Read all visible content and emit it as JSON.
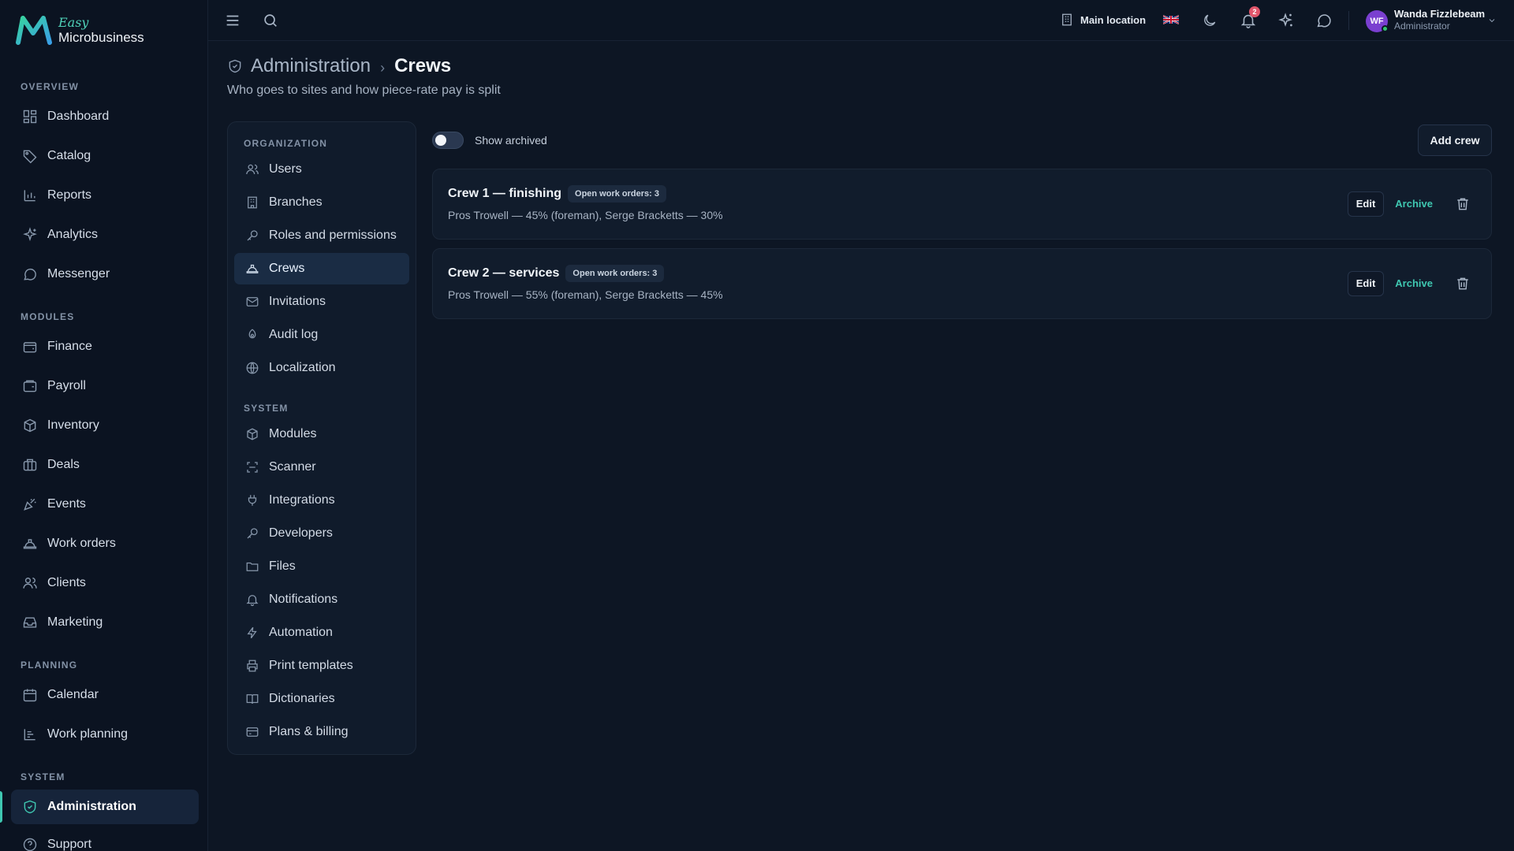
{
  "brand": {
    "line1": "Easy",
    "line2": "Microbusiness"
  },
  "colors": {
    "accent": "#3fc7b1",
    "background": "#0d1624",
    "badge": "#e0566b",
    "avatar": "#7a3fd0"
  },
  "sidebar": {
    "sections": [
      {
        "label": "OVERVIEW",
        "items": [
          {
            "label": "Dashboard",
            "icon": "dashboard-icon"
          },
          {
            "label": "Catalog",
            "icon": "tag-icon"
          },
          {
            "label": "Reports",
            "icon": "bar-chart-icon"
          },
          {
            "label": "Analytics",
            "icon": "sparkle-icon"
          },
          {
            "label": "Messenger",
            "icon": "chat-bubble-icon"
          }
        ]
      },
      {
        "label": "MODULES",
        "items": [
          {
            "label": "Finance",
            "icon": "wallet-icon"
          },
          {
            "label": "Payroll",
            "icon": "wallet-icon"
          },
          {
            "label": "Inventory",
            "icon": "box-icon"
          },
          {
            "label": "Deals",
            "icon": "briefcase-icon"
          },
          {
            "label": "Events",
            "icon": "party-icon"
          },
          {
            "label": "Work orders",
            "icon": "hard-hat-icon"
          },
          {
            "label": "Clients",
            "icon": "users-icon"
          },
          {
            "label": "Marketing",
            "icon": "inbox-icon"
          }
        ]
      },
      {
        "label": "PLANNING",
        "items": [
          {
            "label": "Calendar",
            "icon": "calendar-icon"
          },
          {
            "label": "Work planning",
            "icon": "timeline-icon"
          }
        ]
      },
      {
        "label": "SYSTEM",
        "items": [
          {
            "label": "Administration",
            "icon": "shield-icon",
            "active": true
          },
          {
            "label": "Support",
            "icon": "help-circle-icon"
          }
        ]
      }
    ]
  },
  "topbar": {
    "location": "Main location",
    "notification_count": "2",
    "user": {
      "initials": "WF",
      "name": "Wanda Fizzlebeam",
      "role": "Administrator"
    }
  },
  "header": {
    "parent": "Administration",
    "separator": "›",
    "current": "Crews",
    "subtitle": "Who goes to sites and how piece-rate pay is split"
  },
  "subnav": {
    "sections": [
      {
        "label": "ORGANIZATION",
        "items": [
          {
            "label": "Users",
            "icon": "users-icon"
          },
          {
            "label": "Branches",
            "icon": "building-icon"
          },
          {
            "label": "Roles and permissions",
            "icon": "key-icon"
          },
          {
            "label": "Crews",
            "icon": "hard-hat-icon",
            "active": true
          },
          {
            "label": "Invitations",
            "icon": "mail-icon"
          },
          {
            "label": "Audit log",
            "icon": "audit-icon"
          },
          {
            "label": "Localization",
            "icon": "globe-icon"
          }
        ]
      },
      {
        "label": "SYSTEM",
        "items": [
          {
            "label": "Modules",
            "icon": "box-icon"
          },
          {
            "label": "Scanner",
            "icon": "scan-icon"
          },
          {
            "label": "Integrations",
            "icon": "plug-icon"
          },
          {
            "label": "Developers",
            "icon": "key-icon"
          },
          {
            "label": "Files",
            "icon": "folder-icon"
          },
          {
            "label": "Notifications",
            "icon": "bell-icon"
          },
          {
            "label": "Automation",
            "icon": "bolt-icon"
          },
          {
            "label": "Print templates",
            "icon": "printer-icon"
          },
          {
            "label": "Dictionaries",
            "icon": "book-icon"
          },
          {
            "label": "Plans & billing",
            "icon": "credit-card-icon"
          }
        ]
      }
    ]
  },
  "main": {
    "show_archived_label": "Show archived",
    "show_archived": false,
    "add_button": "Add crew",
    "crews": [
      {
        "name": "Crew 1 — finishing",
        "badge": "Open work orders: 3",
        "members": "Pros Trowell — 45% (foreman), Serge Bracketts — 30%",
        "edit": "Edit",
        "archive": "Archive"
      },
      {
        "name": "Crew 2 — services",
        "badge": "Open work orders: 3",
        "members": "Pros Trowell — 55% (foreman), Serge Bracketts — 45%",
        "edit": "Edit",
        "archive": "Archive"
      }
    ]
  }
}
